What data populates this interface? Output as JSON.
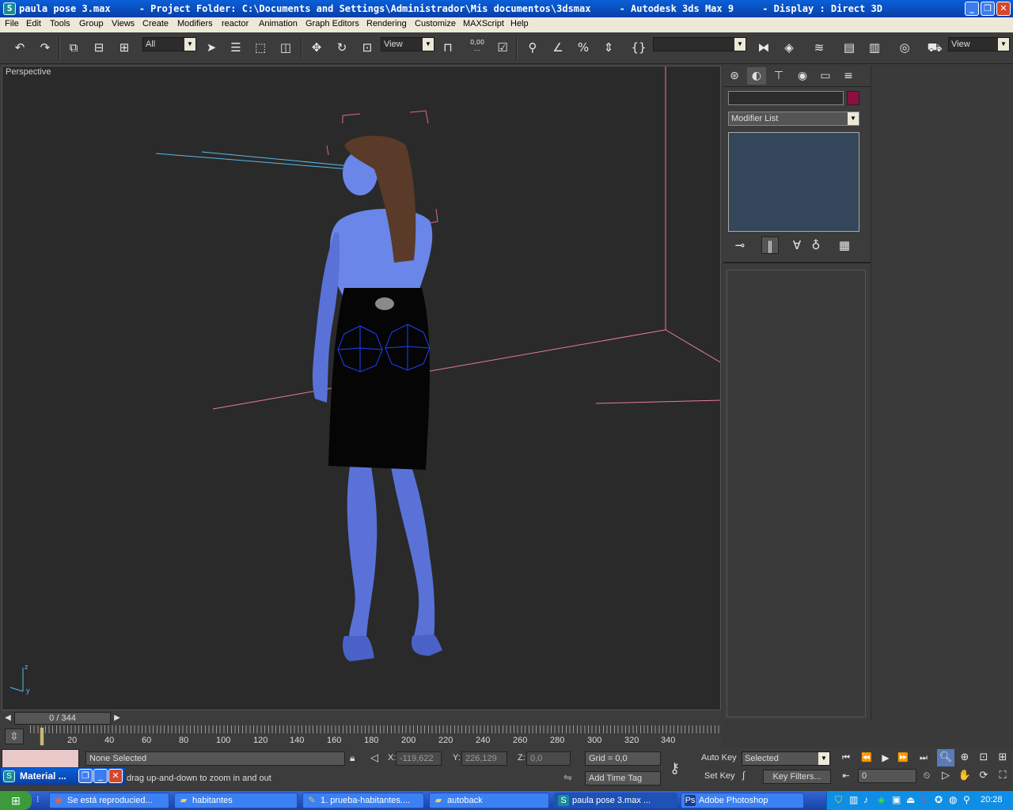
{
  "window": {
    "title": "paula pose 3.max     - Project Folder: C:\\Documents and Settings\\Administrador\\Mis documentos\\3dsmax     - Autodesk 3ds Max 9     - Display : Direct 3D",
    "min_glyph": "_",
    "max_glyph": "❐",
    "close_glyph": "✕",
    "app_glyph": "S"
  },
  "menu": [
    "File",
    "Edit",
    "Tools",
    "Group",
    "Views",
    "Create",
    "Modifiers",
    "reactor",
    "Animation",
    "Graph Editors",
    "Rendering",
    "Customize",
    "MAXScript",
    "Help"
  ],
  "toolbar": {
    "selection_filter": "All",
    "ref_coord": "View",
    "named_selection": "",
    "view_dropdown": "View",
    "spinner_label": "0,00"
  },
  "viewport": {
    "label": "Perspective",
    "axis_z": "z",
    "axis_y": "y"
  },
  "command_panel": {
    "object_name": "",
    "object_color": "#8a1040",
    "modifier_list": "Modifier List"
  },
  "time_slider": {
    "label": "0 / 344"
  },
  "track_ticks": [
    "20",
    "40",
    "60",
    "80",
    "100",
    "120",
    "140",
    "160",
    "180",
    "200",
    "220",
    "240",
    "260",
    "280",
    "300",
    "320",
    "340"
  ],
  "status": {
    "selection": "None Selected",
    "prompt": "drag up-and-down to zoom in and out",
    "x_label": "X:",
    "x_value": "-119,622",
    "y_label": "Y:",
    "y_value": "226,129",
    "z_label": "Z:",
    "z_value": "0,0",
    "grid": "Grid = 0,0",
    "add_time_tag": "Add Time Tag",
    "auto_key": "Auto Key",
    "set_key": "Set Key",
    "key_mode": "Selected",
    "key_filters": "Key Filters...",
    "frame": "0",
    "material_window": "Material ..."
  },
  "taskbar": {
    "tasks": [
      {
        "label": "Se está reproducied...",
        "icon": "media-player-icon"
      },
      {
        "label": "habitantes",
        "icon": "folder-icon"
      },
      {
        "label": "1. prueba-habitantes....",
        "icon": "document-icon"
      },
      {
        "label": "autoback",
        "icon": "folder-icon"
      },
      {
        "label": "paula pose 3.max    ...",
        "icon": "3dsmax-icon"
      },
      {
        "label": "Adobe Photoshop",
        "icon": "photoshop-icon"
      }
    ],
    "clock": "20:28"
  }
}
